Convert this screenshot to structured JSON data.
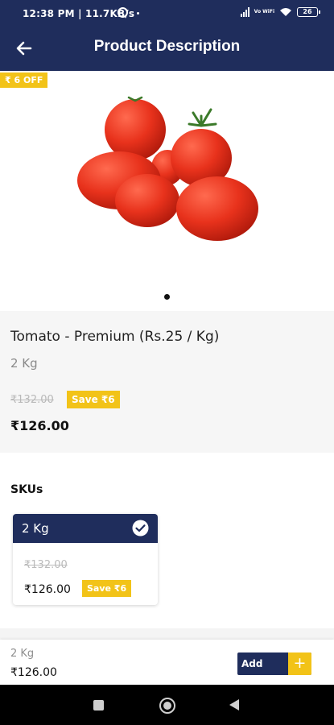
{
  "status_bar": {
    "time_speed": "12:38 PM | 11.7KB/s",
    "network_label": "Vo WiFi",
    "battery": "26"
  },
  "header": {
    "title": "Product Description"
  },
  "product": {
    "discount_badge": "₹ 6 OFF",
    "name": "Tomato - Premium  (Rs.25 / Kg)",
    "weight": "2 Kg",
    "mrp": "₹132.00",
    "save_label": "Save ₹6",
    "price": "₹126.00"
  },
  "skus": {
    "title": "SKUs",
    "items": [
      {
        "label": "2 Kg",
        "mrp": "₹132.00",
        "price": "₹126.00",
        "save_label": "Save ₹6",
        "selected": true
      }
    ]
  },
  "bottom_bar": {
    "weight": "2 Kg",
    "price": "₹126.00",
    "add_label": "Add",
    "add_icon": "+"
  },
  "colors": {
    "primary": "#1f2d5c",
    "accent": "#f2c318"
  },
  "icons": [
    "back-arrow-icon",
    "check-circle-icon",
    "plus-icon",
    "wifi-icon",
    "battery-icon",
    "alarm-icon"
  ]
}
